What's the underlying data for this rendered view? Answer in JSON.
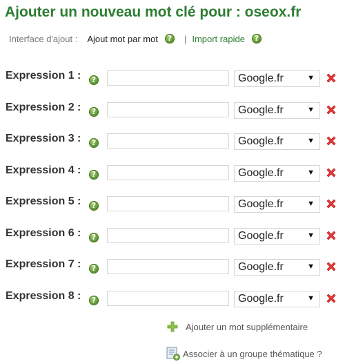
{
  "header": {
    "title": "Ajouter un nouveau mot clé pour : oseox.fr"
  },
  "interface": {
    "label": "Interface d'ajout :",
    "current_mode": "Ajout mot par mot",
    "separator": "|",
    "alt_mode_link": "Import rapide",
    "help_glyph": "?"
  },
  "expressions": [
    {
      "label": "Expression 1 :",
      "value": "",
      "engine": "Google.fr"
    },
    {
      "label": "Expression 2 :",
      "value": "",
      "engine": "Google.fr"
    },
    {
      "label": "Expression 3 :",
      "value": "",
      "engine": "Google.fr"
    },
    {
      "label": "Expression 4 :",
      "value": "",
      "engine": "Google.fr"
    },
    {
      "label": "Expression 5 :",
      "value": "",
      "engine": "Google.fr"
    },
    {
      "label": "Expression 6 :",
      "value": "",
      "engine": "Google.fr"
    },
    {
      "label": "Expression 7 :",
      "value": "",
      "engine": "Google.fr"
    },
    {
      "label": "Expression 8 :",
      "value": "",
      "engine": "Google.fr"
    }
  ],
  "actions": {
    "add_word": "Ajouter un mot supplémentaire",
    "associate_group": "Associer à un groupe thématique ?"
  },
  "icons": {
    "help": "help-icon",
    "delete": "delete-x-icon",
    "add": "plus-icon",
    "group": "document-add-icon"
  },
  "colors": {
    "accent_green": "#2e7d32",
    "delete_red": "#e53935"
  }
}
